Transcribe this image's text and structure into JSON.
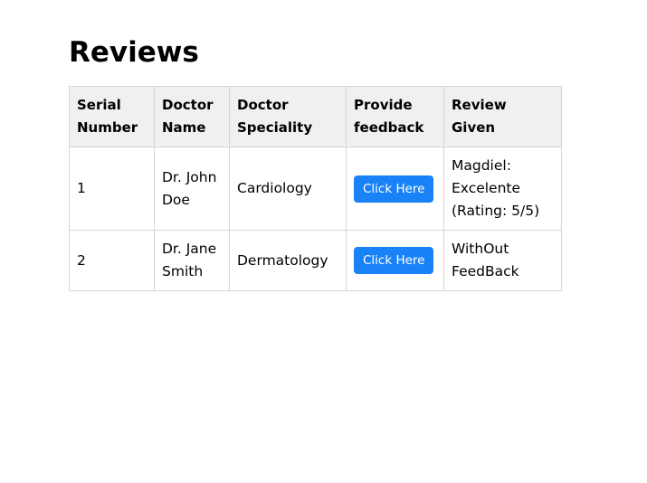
{
  "page": {
    "title": "Reviews"
  },
  "table": {
    "headers": {
      "serial": "Serial Number",
      "doctor_name": "Doctor Name",
      "speciality": "Doctor Speciality",
      "feedback": "Provide feedback",
      "review": "Review Given"
    },
    "rows": [
      {
        "serial": "1",
        "doctor_name": "Dr. John Doe",
        "speciality": "Cardiology",
        "button_label": "Click Here",
        "review": "Magdiel: Excelente (Rating: 5/5)"
      },
      {
        "serial": "2",
        "doctor_name": "Dr. Jane Smith",
        "speciality": "Dermatology",
        "button_label": "Click Here",
        "review": "WithOut FeedBack"
      }
    ]
  },
  "colors": {
    "button_background": "#1a82f7",
    "header_background": "#f0f0f0",
    "border": "#d5d5d5"
  }
}
